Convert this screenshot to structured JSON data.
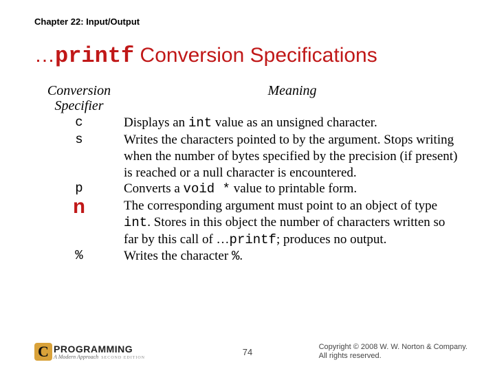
{
  "chapter": "Chapter 22: Input/Output",
  "title": {
    "prefix": "…",
    "mono": "printf",
    "rest": " Conversion Specifications"
  },
  "table": {
    "header_spec": "Conversion Specifier",
    "header_mean": "Meaning",
    "rows": [
      {
        "spec": "c",
        "spec_big": false,
        "segments": [
          {
            "t": "Displays an "
          },
          {
            "t": "int",
            "mono": true
          },
          {
            "t": " value as an unsigned character."
          }
        ]
      },
      {
        "spec": "s",
        "spec_big": false,
        "segments": [
          {
            "t": "Writes the characters pointed to by the argument. Stops writing when the number of bytes specified by the precision (if present) is reached or a null character is encountered."
          }
        ]
      },
      {
        "spec": "p",
        "spec_big": false,
        "segments": [
          {
            "t": "Converts a "
          },
          {
            "t": "void *",
            "mono": true
          },
          {
            "t": " value to printable form."
          }
        ]
      },
      {
        "spec": "n",
        "spec_big": true,
        "segments": [
          {
            "t": "The corresponding argument must point to an object of type "
          },
          {
            "t": "int",
            "mono": true
          },
          {
            "t": ". Stores in this object the number of characters written so far by this call of …"
          },
          {
            "t": "printf",
            "mono": true
          },
          {
            "t": "; produces no output."
          }
        ]
      },
      {
        "spec": "%",
        "spec_big": false,
        "segments": [
          {
            "t": "Writes the character "
          },
          {
            "t": "%",
            "mono": true
          },
          {
            "t": "."
          }
        ]
      }
    ]
  },
  "footer": {
    "logo_c": "C",
    "logo_prog": "PROGRAMMING",
    "logo_sub": "A Modern Approach",
    "logo_ed": "SECOND EDITION",
    "page": "74",
    "copy1": "Copyright © 2008 W. W. Norton & Company.",
    "copy2": "All rights reserved."
  }
}
